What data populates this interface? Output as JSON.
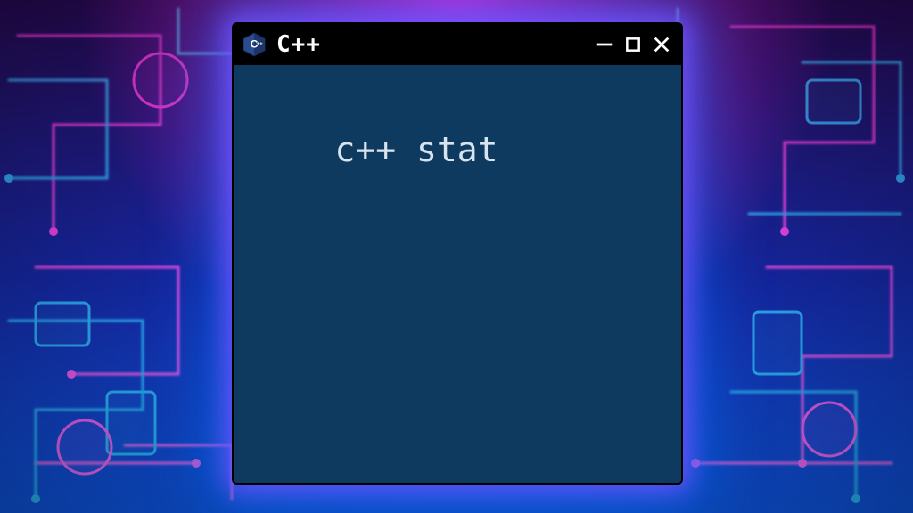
{
  "window": {
    "title": "C++",
    "content": "c++ stat",
    "icon": "cpp-logo-icon"
  }
}
